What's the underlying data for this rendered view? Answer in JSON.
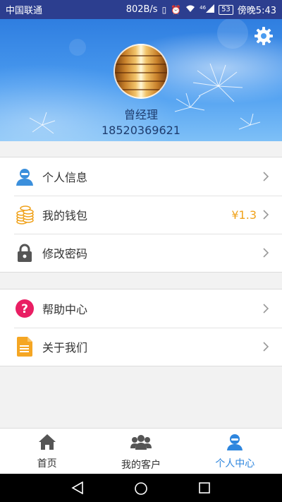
{
  "status_bar": {
    "carrier": "中国联通",
    "speed": "802B/s",
    "signal": "46",
    "battery": "53",
    "time": "傍晚5:43"
  },
  "profile": {
    "name": "曾经理",
    "phone": "18520369621"
  },
  "menu_group_1": [
    {
      "label": "个人信息",
      "icon": "person-icon",
      "value": ""
    },
    {
      "label": "我的钱包",
      "icon": "coins-icon",
      "value": "¥1.3"
    },
    {
      "label": "修改密码",
      "icon": "lock-icon",
      "value": ""
    }
  ],
  "menu_group_2": [
    {
      "label": "帮助中心",
      "icon": "help-icon",
      "value": ""
    },
    {
      "label": "关于我们",
      "icon": "document-icon",
      "value": ""
    }
  ],
  "bottom_nav": {
    "tabs": [
      {
        "label": "首页",
        "icon": "home-icon",
        "active": false
      },
      {
        "label": "我的客户",
        "icon": "group-icon",
        "active": false
      },
      {
        "label": "个人中心",
        "icon": "person-icon",
        "active": true
      }
    ]
  },
  "colors": {
    "status_bar": "#2c3e8f",
    "accent": "#2e86de",
    "wallet_value": "#f0a21b",
    "help_icon": "#e91e63",
    "document_icon": "#f5a623",
    "person_icon": "#3b8fdc"
  }
}
